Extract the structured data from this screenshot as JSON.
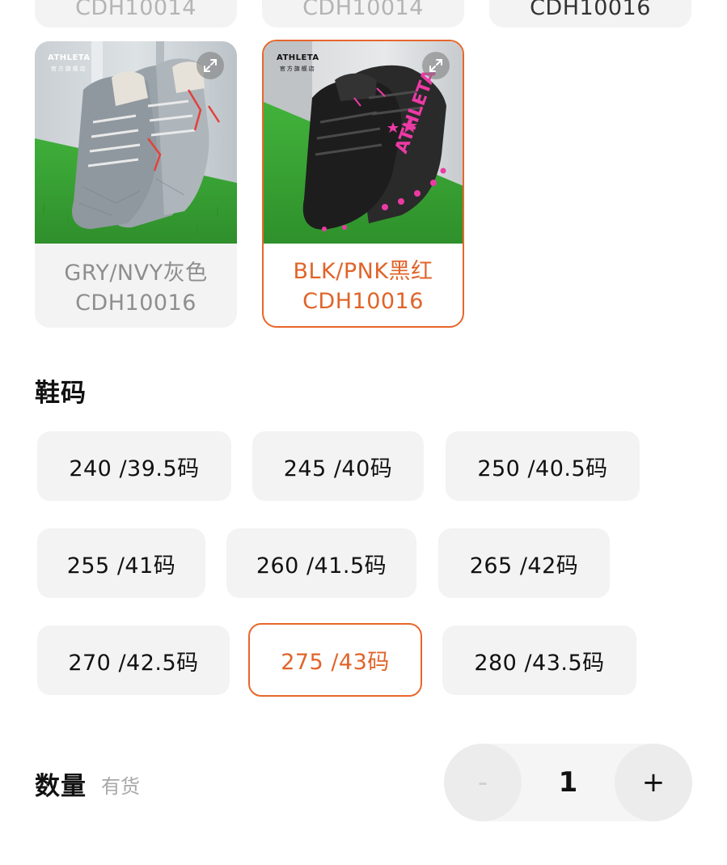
{
  "color_options": [
    {
      "label_line1": "",
      "label_line2": "CDH10014",
      "selected": false
    },
    {
      "label_line1": "",
      "label_line2": "CDH10014",
      "selected": false
    },
    {
      "label_line1": "",
      "label_line2": "CDH10016",
      "selected": false
    },
    {
      "label_line1": "GRY/NVY灰色",
      "label_line2": "CDH10016",
      "selected": false
    },
    {
      "label_line1": "BLK/PNK黑红",
      "label_line2": "CDH10016",
      "selected": true
    }
  ],
  "brand": {
    "name": "ATHLETA",
    "sub": "官方旗舰店"
  },
  "size_section": {
    "title": "鞋码",
    "options": [
      {
        "label": "240 /39.5码",
        "selected": false
      },
      {
        "label": "245 /40码",
        "selected": false
      },
      {
        "label": "250 /40.5码",
        "selected": false
      },
      {
        "label": "255 /41码",
        "selected": false
      },
      {
        "label": "260 /41.5码",
        "selected": false
      },
      {
        "label": "265 /42码",
        "selected": false
      },
      {
        "label": "270 /42.5码",
        "selected": false
      },
      {
        "label": "275 /43码",
        "selected": true
      },
      {
        "label": "280 /43.5码",
        "selected": false
      }
    ]
  },
  "quantity_section": {
    "title": "数量",
    "stock_status": "有货",
    "minus_label": "-",
    "value": "1",
    "plus_label": "+"
  },
  "colors": {
    "accent": "#e8662a",
    "chip_bg": "#f3f3f3",
    "muted_text": "#8e8e8e"
  },
  "icons": {
    "expand": "expand-icon"
  }
}
